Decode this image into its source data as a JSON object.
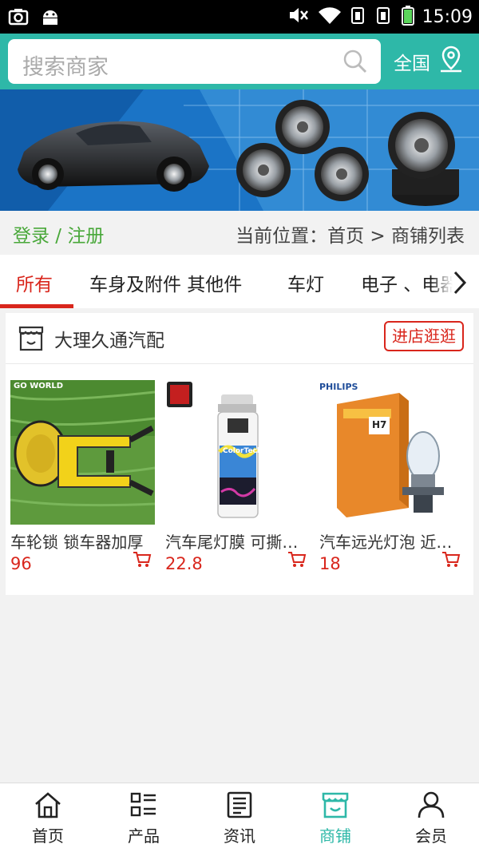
{
  "status_bar": {
    "time": "15:09"
  },
  "search": {
    "placeholder": "搜索商家",
    "region": "全国"
  },
  "location_row": {
    "login_register": "登录 / 注册",
    "breadcrumb": "当前位置：首页 > 商铺列表"
  },
  "tabs": [
    {
      "label": "所有",
      "active": true
    },
    {
      "label": "车身及附件 其他件"
    },
    {
      "label": "车灯"
    },
    {
      "label": "电子 、电器"
    }
  ],
  "shop": {
    "name": "大理久通汽配",
    "visit_label": "进店逛逛",
    "products": [
      {
        "name": "车轮锁 锁车器加厚",
        "price": "96",
        "brand_text": "GO WORLD"
      },
      {
        "name": "汽车尾灯膜 可撕喷漆",
        "price": "22.8",
        "brand_text": "ColorTech"
      },
      {
        "name": "汽车远光灯泡 近光灯",
        "price": "18",
        "brand_text": "PHILIPS",
        "badge": "H7"
      }
    ]
  },
  "bottom_nav": [
    {
      "label": "首页",
      "icon": "home-icon"
    },
    {
      "label": "产品",
      "icon": "grid-list-icon"
    },
    {
      "label": "资讯",
      "icon": "news-icon"
    },
    {
      "label": "商铺",
      "icon": "shop-icon",
      "active": true
    },
    {
      "label": "会员",
      "icon": "user-icon"
    }
  ],
  "colors": {
    "header_teal": "#2eb8a8",
    "accent_red": "#d9261c",
    "login_green": "#49a83a"
  }
}
